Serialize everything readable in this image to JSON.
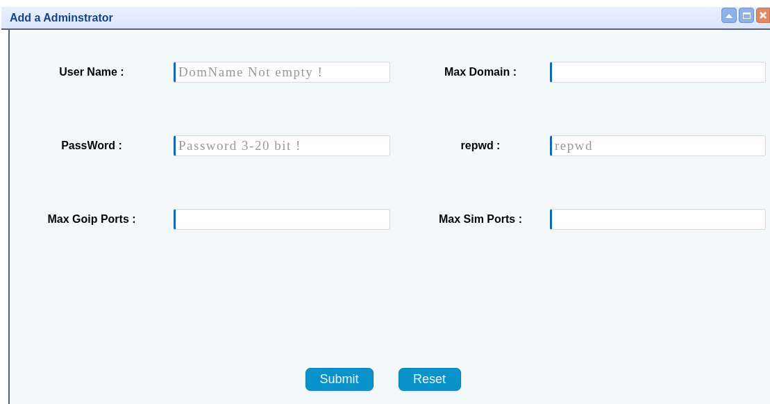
{
  "window": {
    "title": "Add a Adminstrator"
  },
  "fields": [
    {
      "label": "User Name :",
      "placeholder": "DomName Not empty !"
    },
    {
      "label": "Max Domain :"
    },
    {
      "label": "PassWord :",
      "placeholder": "Password 3-20 bit !"
    },
    {
      "label": "repwd :",
      "placeholder": "repwd"
    },
    {
      "label": "Max Goip Ports :"
    },
    {
      "label": "Max Sim Ports :"
    }
  ],
  "buttons": [
    "Submit",
    "Reset"
  ]
}
